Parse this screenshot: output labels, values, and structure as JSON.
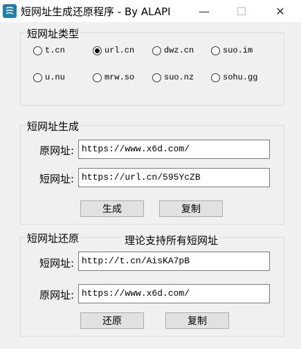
{
  "window": {
    "title": "短网址生成还原程序 - By ALAPI",
    "minimize_glyph": "—",
    "maximize_glyph": "☐",
    "close_glyph": "✕"
  },
  "type_group": {
    "legend": "短网址类型",
    "options": [
      {
        "label": "t.cn",
        "selected": false
      },
      {
        "label": "url.cn",
        "selected": true
      },
      {
        "label": "dwz.cn",
        "selected": false
      },
      {
        "label": "suo.im",
        "selected": false
      },
      {
        "label": "u.nu",
        "selected": false
      },
      {
        "label": "mrw.so",
        "selected": false
      },
      {
        "label": "suo.nz",
        "selected": false
      },
      {
        "label": "sohu.gg",
        "selected": false
      }
    ]
  },
  "generate_group": {
    "legend": "短网址生成",
    "original_label": "原网址:",
    "original_value": "https://www.x6d.com/",
    "short_label": "短网址:",
    "short_value": "https://url.cn/595YcZB",
    "generate_button": "生成",
    "copy_button": "复制"
  },
  "restore_group": {
    "legend": "短网址还原",
    "note": "理论支持所有短网址",
    "short_label": "短网址:",
    "short_value": "http://t.cn/AisKA7pB",
    "original_label": "原网址:",
    "original_value": "https://www.x6d.com/",
    "restore_button": "还原",
    "copy_button": "复制"
  }
}
